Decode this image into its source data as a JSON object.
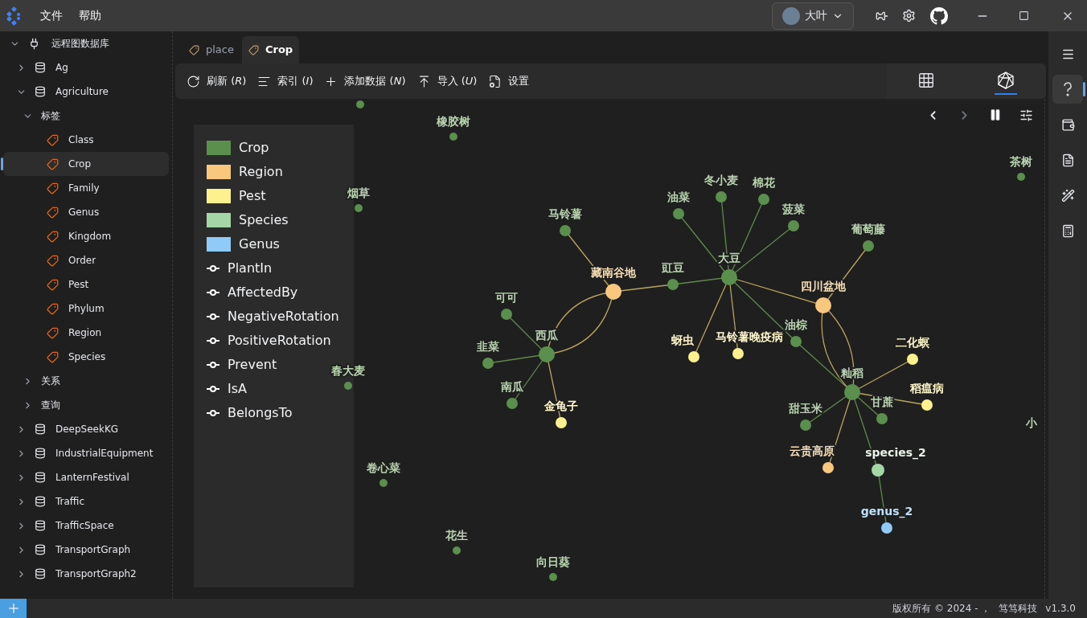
{
  "menu": [
    "文件",
    "帮助"
  ],
  "user": {
    "name": "大叶"
  },
  "sidebar": {
    "items": [
      {
        "kind": "connection",
        "label": "远程图数据库",
        "expanded": true,
        "selected": false,
        "children": [
          {
            "kind": "database",
            "label": "Ag",
            "expanded": false,
            "selected": false
          },
          {
            "kind": "database",
            "label": "Agriculture",
            "expanded": true,
            "selected": false,
            "children": [
              {
                "kind": "folder",
                "label": "标签",
                "expanded": true,
                "selected": false,
                "children": [
                  {
                    "kind": "tag",
                    "label": "Class",
                    "selected": false
                  },
                  {
                    "kind": "tag",
                    "label": "Crop",
                    "selected": true
                  },
                  {
                    "kind": "tag",
                    "label": "Family",
                    "selected": false
                  },
                  {
                    "kind": "tag",
                    "label": "Genus",
                    "selected": false
                  },
                  {
                    "kind": "tag",
                    "label": "Kingdom",
                    "selected": false
                  },
                  {
                    "kind": "tag",
                    "label": "Order",
                    "selected": false
                  },
                  {
                    "kind": "tag",
                    "label": "Pest",
                    "selected": false
                  },
                  {
                    "kind": "tag",
                    "label": "Phylum",
                    "selected": false
                  },
                  {
                    "kind": "tag",
                    "label": "Region",
                    "selected": false
                  },
                  {
                    "kind": "tag",
                    "label": "Species",
                    "selected": false
                  }
                ]
              },
              {
                "kind": "folder",
                "label": "关系",
                "expanded": false,
                "selected": false
              },
              {
                "kind": "folder",
                "label": "查询",
                "expanded": false,
                "selected": false
              }
            ]
          },
          {
            "kind": "database",
            "label": "DeepSeekKG",
            "expanded": false,
            "selected": false
          },
          {
            "kind": "database",
            "label": "IndustrialEquipment",
            "expanded": false,
            "selected": false
          },
          {
            "kind": "database",
            "label": "LanternFestival",
            "expanded": false,
            "selected": false
          },
          {
            "kind": "database",
            "label": "Traffic",
            "expanded": false,
            "selected": false
          },
          {
            "kind": "database",
            "label": "TrafficSpace",
            "expanded": false,
            "selected": false
          },
          {
            "kind": "database",
            "label": "TransportGraph",
            "expanded": false,
            "selected": false
          },
          {
            "kind": "database",
            "label": "TransportGraph2",
            "expanded": false,
            "selected": false
          }
        ]
      }
    ]
  },
  "tabs": [
    {
      "label": "place",
      "selected": false
    },
    {
      "label": "Crop",
      "selected": true
    }
  ],
  "toolbar": [
    {
      "kind": "refresh",
      "label": "刷新 (*R*)"
    },
    {
      "kind": "index",
      "label": "索引 (*I*)"
    },
    {
      "kind": "add",
      "label": "添加数据 (*N*)"
    },
    {
      "kind": "import",
      "label": "导入 (*U*)"
    },
    {
      "kind": "settings",
      "label": "设置"
    }
  ],
  "view_modes": [
    {
      "kind": "table",
      "selected": false
    },
    {
      "kind": "graph",
      "selected": true
    }
  ],
  "legend": {
    "node_types": [
      {
        "label": "Crop",
        "color": "#5b8f4e"
      },
      {
        "label": "Region",
        "color": "#f9c77e"
      },
      {
        "label": "Pest",
        "color": "#fdf08f"
      },
      {
        "label": "Species",
        "color": "#a5d6a7"
      },
      {
        "label": "Genus",
        "color": "#90caf9"
      }
    ],
    "edge_types": [
      "PlantIn",
      "AffectedBy",
      "NegativeRotation",
      "PositiveRotation",
      "Prevent",
      "IsA",
      "BelongsTo"
    ]
  },
  "graph": {
    "nodes": [
      {
        "kind": "crop"
      },
      {
        "kind": "crop",
        "label": "橡胶树"
      },
      {
        "kind": "crop",
        "label": "茶树"
      },
      {
        "kind": "crop",
        "label": "烟草"
      },
      {
        "kind": "crop",
        "label": "马铃薯"
      },
      {
        "kind": "crop",
        "label": "油菜"
      },
      {
        "kind": "crop",
        "label": "冬小麦"
      },
      {
        "kind": "crop",
        "label": "棉花"
      },
      {
        "kind": "crop",
        "label": "菠菜"
      },
      {
        "kind": "crop",
        "label": "葡萄藤"
      },
      {
        "kind": "crop",
        "label": "豇豆"
      },
      {
        "kind": "crop",
        "label": "大豆"
      },
      {
        "kind": "region",
        "label": "藏南谷地"
      },
      {
        "kind": "region",
        "label": "四川盆地"
      },
      {
        "kind": "crop",
        "label": "可可"
      },
      {
        "kind": "crop",
        "label": "西瓜"
      },
      {
        "kind": "crop",
        "label": "韭菜"
      },
      {
        "kind": "crop",
        "label": "南瓜"
      },
      {
        "kind": "crop",
        "label": "春大麦"
      },
      {
        "kind": "crop",
        "label": "油棕"
      },
      {
        "kind": "pest",
        "label": "蚜虫"
      },
      {
        "kind": "pest",
        "label": "马铃薯晚疫病"
      },
      {
        "kind": "pest",
        "label": "金龟子"
      },
      {
        "kind": "pest",
        "label": "二化螟"
      },
      {
        "kind": "pest",
        "label": "稻瘟病"
      },
      {
        "kind": "crop",
        "label": "籼稻"
      },
      {
        "kind": "crop",
        "label": "甜玉米"
      },
      {
        "kind": "crop",
        "label": "甘蔗"
      },
      {
        "kind": "region",
        "label": "云贵高原"
      },
      {
        "kind": "species",
        "label": "species_2"
      },
      {
        "kind": "genus",
        "label": "genus_2"
      },
      {
        "kind": "crop",
        "label": "卷心菜"
      },
      {
        "kind": "crop",
        "label": "花生"
      },
      {
        "kind": "crop",
        "label": "向日葵"
      },
      {
        "kind": "crop",
        "label": "小"
      }
    ]
  },
  "right_rail": [
    {
      "kind": "menu",
      "selected": false
    },
    {
      "kind": "help",
      "selected": true
    },
    {
      "kind": "wallet",
      "selected": false
    },
    {
      "kind": "document",
      "selected": false
    },
    {
      "kind": "wand",
      "selected": false
    },
    {
      "kind": "calculator",
      "selected": false
    }
  ],
  "status_bar": {
    "copyright": "版权所有 © 2024 - ，",
    "company": "笃笃科技",
    "version": "v1.3.0"
  }
}
